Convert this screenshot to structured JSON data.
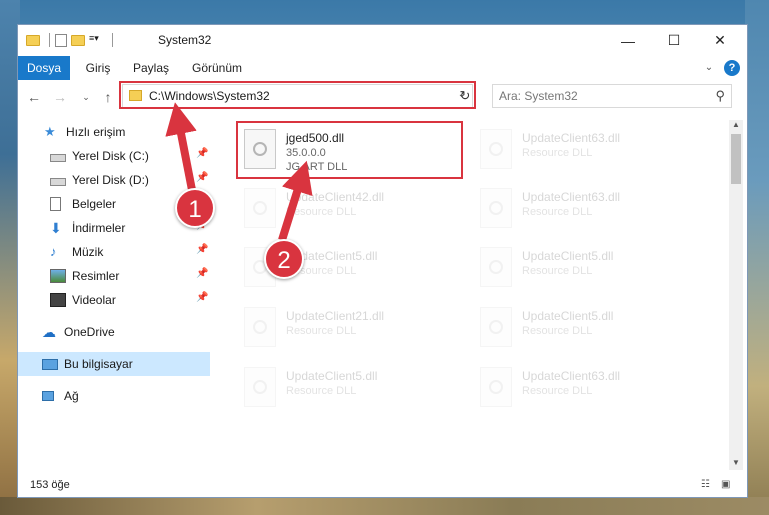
{
  "window": {
    "title": "System32",
    "controls": {
      "minimize": "—",
      "maximize": "☐",
      "close": "✕"
    }
  },
  "ribbon": {
    "tabs": [
      {
        "label": "Dosya",
        "active": true
      },
      {
        "label": "Giriş",
        "active": false
      },
      {
        "label": "Paylaş",
        "active": false
      },
      {
        "label": "Görünüm",
        "active": false
      }
    ],
    "expand_icon": "chevron-down-icon",
    "help_icon": "?"
  },
  "address": {
    "path": "C:\\Windows\\System32",
    "search_placeholder": "Ara: System32"
  },
  "navigation": {
    "items": [
      {
        "label": "Hızlı erişim",
        "icon": "star-icon",
        "pinned": false
      },
      {
        "label": "Yerel Disk (C:)",
        "icon": "drive-icon",
        "pinned": true
      },
      {
        "label": "Yerel Disk (D:)",
        "icon": "drive-icon",
        "pinned": true
      },
      {
        "label": "Belgeler",
        "icon": "documents-icon",
        "pinned": true
      },
      {
        "label": "İndirmeler",
        "icon": "downloads-icon",
        "pinned": true
      },
      {
        "label": "Müzik",
        "icon": "music-icon",
        "pinned": true
      },
      {
        "label": "Resimler",
        "icon": "pictures-icon",
        "pinned": true
      },
      {
        "label": "Videolar",
        "icon": "videos-icon",
        "pinned": true
      },
      {
        "label": "OneDrive",
        "icon": "cloud-icon",
        "pinned": false
      },
      {
        "label": "Bu bilgisayar",
        "icon": "computer-icon",
        "pinned": false,
        "selected": true
      },
      {
        "label": "Ağ",
        "icon": "network-icon",
        "pinned": false
      }
    ]
  },
  "files": [
    {
      "name": "jged500.dll",
      "line1": "35.0.0.0",
      "line2": "JG ART DLL",
      "highlighted": true
    },
    {
      "name": "UpdateClient63.dll",
      "line1": "Resource DLL",
      "line2": ""
    },
    {
      "name": "UpdateClient42.dll",
      "line1": "Resource DLL",
      "line2": ""
    },
    {
      "name": "UpdateClient63.dll",
      "line1": "Resource DLL",
      "line2": ""
    },
    {
      "name": "UpdateClient5.dll",
      "line1": "Resource DLL",
      "line2": ""
    },
    {
      "name": "UpdateClient5.dll",
      "line1": "Resource DLL",
      "line2": ""
    },
    {
      "name": "UpdateClient21.dll",
      "line1": "Resource DLL",
      "line2": ""
    },
    {
      "name": "UpdateClient5.dll",
      "line1": "Resource DLL",
      "line2": ""
    },
    {
      "name": "UpdateClient5.dll",
      "line1": "Resource DLL",
      "line2": ""
    },
    {
      "name": "UpdateClient63.dll",
      "line1": "Resource DLL",
      "line2": ""
    }
  ],
  "status": {
    "count": "153 öğe"
  },
  "annotations": {
    "badge1": "1",
    "badge2": "2",
    "color": "#d9343f"
  }
}
